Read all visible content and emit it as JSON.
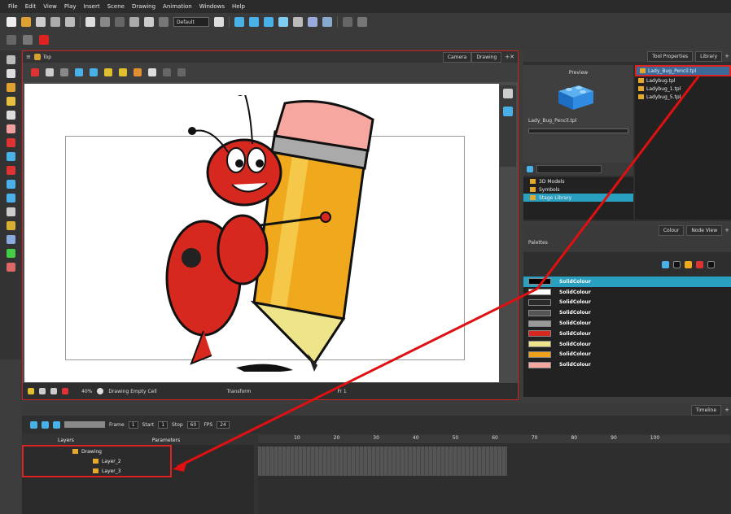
{
  "menu": [
    "File",
    "Edit",
    "View",
    "Play",
    "Insert",
    "Scene",
    "Drawing",
    "Animation",
    "Windows",
    "Help"
  ],
  "toolbar": {
    "workspace_select": "Default"
  },
  "camera": {
    "title": "Top",
    "tabs": [
      "Camera",
      "Drawing"
    ],
    "footer": {
      "zoom": "40%",
      "status": "Drawing Empty Cell",
      "transform": "Transform",
      "frame": "Fr 1"
    }
  },
  "library": {
    "tabs": [
      "Tool Properties",
      "Library"
    ],
    "preview_label": "Preview",
    "preview_file": "Lady_Bug_Pencil.tpl",
    "files": [
      "Lady_Bug_Pencil.tpl",
      "Ladybug.tpl",
      "Ladybug_1.tpl",
      "Ladybug_5.tpl"
    ],
    "tree": [
      "3D Models",
      "Symbols",
      "Stage Library"
    ]
  },
  "colour": {
    "tabs": [
      "Colour",
      "Node View"
    ],
    "palettes_label": "Palettes",
    "swatches": [
      {
        "name": "SolidColour",
        "color": "#000000"
      },
      {
        "name": "SolidColour",
        "color": "#ffffff"
      },
      {
        "name": "SolidColour",
        "color": "#2a2a2a"
      },
      {
        "name": "SolidColour",
        "color": "#555555"
      },
      {
        "name": "SolidColour",
        "color": "#9a9a9a"
      },
      {
        "name": "SolidColour",
        "color": "#d6281e"
      },
      {
        "name": "SolidColour",
        "color": "#eee48a"
      },
      {
        "name": "SolidColour",
        "color": "#f0a11c"
      },
      {
        "name": "SolidColour",
        "color": "#f6a8a0"
      }
    ]
  },
  "timeline": {
    "tab": "Timeline",
    "frame_label": "Frame",
    "frame_value": "1",
    "start_label": "Start",
    "start_value": "1",
    "stop_label": "Stop",
    "stop_value": "60",
    "fps_label": "FPS",
    "fps_value": "24",
    "columns": {
      "layers": "Layers",
      "params": "Parameters"
    },
    "layers": [
      "Drawing",
      "Layer_2",
      "Layer_3"
    ],
    "ruler": [
      "10",
      "20",
      "30",
      "40",
      "50",
      "60",
      "70",
      "80",
      "90",
      "100",
      "110"
    ]
  }
}
